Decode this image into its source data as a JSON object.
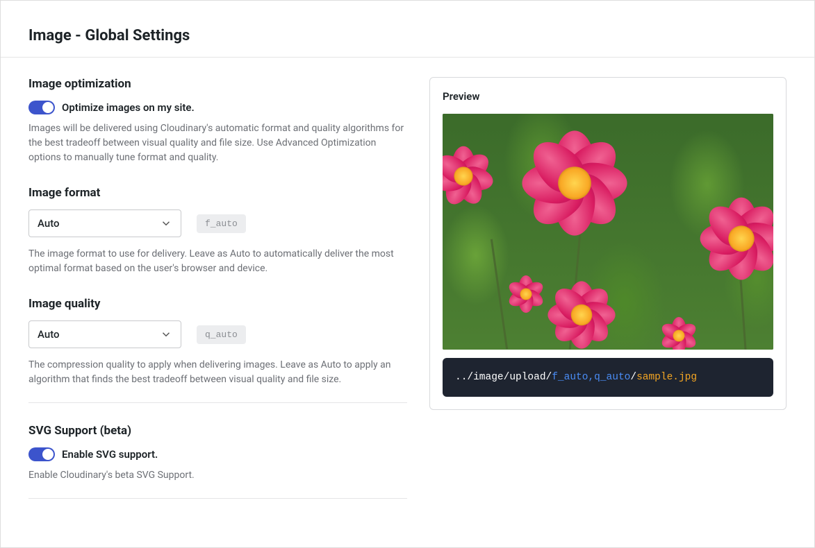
{
  "page_title": "Image - Global Settings",
  "optimization": {
    "title": "Image optimization",
    "toggle_label": "Optimize images on my site.",
    "toggle_on": true,
    "description": "Images will be delivered using Cloudinary's automatic format and quality algorithms for the best tradeoff between visual quality and file size. Use Advanced Optimization options to manually tune format and quality."
  },
  "format": {
    "title": "Image format",
    "selected": "Auto",
    "tag": "f_auto",
    "description": "The image format to use for delivery. Leave as Auto to automatically deliver the most optimal format based on the user's browser and device."
  },
  "quality": {
    "title": "Image quality",
    "selected": "Auto",
    "tag": "q_auto",
    "description": "The compression quality to apply when delivering images. Leave as Auto to apply an algorithm that finds the best tradeoff between visual quality and file size."
  },
  "svg": {
    "title": "SVG Support (beta)",
    "toggle_label": "Enable SVG support.",
    "toggle_on": true,
    "description": "Enable Cloudinary's beta SVG Support."
  },
  "preview": {
    "title": "Preview",
    "url_prefix": "../image/upload/",
    "url_params": "f_auto,q_auto",
    "url_sep": "/",
    "url_file": "sample.jpg"
  }
}
